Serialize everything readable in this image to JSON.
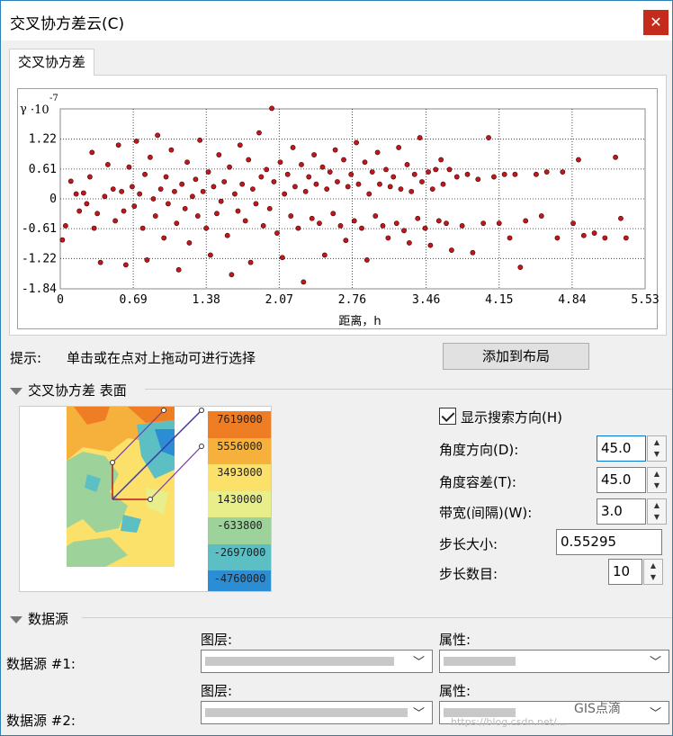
{
  "window": {
    "title": "交叉协方差云(C)",
    "close": "✕"
  },
  "tab": {
    "label": "交叉协方差"
  },
  "plot": {
    "gamma_label": "γ",
    "exp_label": "·10",
    "exp_power": "-7",
    "xlabel": "距离，h"
  },
  "chart_data": {
    "type": "scatter",
    "title": "",
    "xlabel": "距离，h",
    "ylabel": "γ ·10^-7",
    "xlim": [
      0,
      5.53
    ],
    "ylim": [
      -1.84,
      1.84
    ],
    "x_ticks": [
      "0",
      "0.69",
      "1.38",
      "2.07",
      "2.76",
      "3.46",
      "4.15",
      "4.84",
      "5.53"
    ],
    "y_ticks": [
      "1.22",
      "0.61",
      "0",
      "-0.61",
      "-1.22",
      "-1.84"
    ],
    "grid": true,
    "point_color": "#c0181c",
    "series": [
      {
        "points": [
          [
            0.02,
            -0.84
          ],
          [
            0.05,
            -0.55
          ],
          [
            0.1,
            0.36
          ],
          [
            0.15,
            0.1
          ],
          [
            0.18,
            -0.25
          ],
          [
            0.22,
            0.12
          ],
          [
            0.25,
            -0.1
          ],
          [
            0.28,
            0.45
          ],
          [
            0.3,
            0.95
          ],
          [
            0.32,
            -0.6
          ],
          [
            0.35,
            -0.3
          ],
          [
            0.38,
            -1.3
          ],
          [
            0.42,
            0.05
          ],
          [
            0.45,
            0.7
          ],
          [
            0.5,
            0.2
          ],
          [
            0.52,
            -0.45
          ],
          [
            0.55,
            1.1
          ],
          [
            0.58,
            0.15
          ],
          [
            0.6,
            -0.25
          ],
          [
            0.62,
            -1.35
          ],
          [
            0.65,
            0.65
          ],
          [
            0.68,
            0.25
          ],
          [
            0.7,
            -0.15
          ],
          [
            0.72,
            1.18
          ],
          [
            0.75,
            0.1
          ],
          [
            0.78,
            -0.6
          ],
          [
            0.8,
            0.5
          ],
          [
            0.82,
            -1.25
          ],
          [
            0.85,
            0.85
          ],
          [
            0.88,
            0.0
          ],
          [
            0.9,
            -0.35
          ],
          [
            0.92,
            1.3
          ],
          [
            0.95,
            0.2
          ],
          [
            0.98,
            -0.8
          ],
          [
            1.0,
            0.45
          ],
          [
            1.02,
            -0.1
          ],
          [
            1.05,
            1.0
          ],
          [
            1.08,
            0.15
          ],
          [
            1.1,
            -0.5
          ],
          [
            1.12,
            -1.45
          ],
          [
            1.15,
            0.3
          ],
          [
            1.18,
            -0.2
          ],
          [
            1.2,
            0.75
          ],
          [
            1.22,
            -0.9
          ],
          [
            1.25,
            0.05
          ],
          [
            1.28,
            0.4
          ],
          [
            1.3,
            -0.35
          ],
          [
            1.32,
            1.2
          ],
          [
            1.35,
            0.15
          ],
          [
            1.38,
            -0.6
          ],
          [
            1.4,
            0.55
          ],
          [
            1.42,
            -1.15
          ],
          [
            1.45,
            0.25
          ],
          [
            1.48,
            -0.3
          ],
          [
            1.5,
            0.9
          ],
          [
            1.52,
            -0.05
          ],
          [
            1.55,
            0.35
          ],
          [
            1.58,
            -0.75
          ],
          [
            1.6,
            0.65
          ],
          [
            1.62,
            -1.55
          ],
          [
            1.65,
            0.1
          ],
          [
            1.68,
            -0.25
          ],
          [
            1.7,
            1.1
          ],
          [
            1.72,
            0.3
          ],
          [
            1.75,
            -0.45
          ],
          [
            1.78,
            0.8
          ],
          [
            1.8,
            -1.3
          ],
          [
            1.82,
            0.2
          ],
          [
            1.85,
            -0.1
          ],
          [
            1.88,
            1.35
          ],
          [
            1.9,
            0.45
          ],
          [
            1.92,
            -0.55
          ],
          [
            1.95,
            0.6
          ],
          [
            1.98,
            -0.2
          ],
          [
            2.0,
            1.85
          ],
          [
            2.02,
            0.35
          ],
          [
            2.05,
            -0.7
          ],
          [
            2.08,
            0.75
          ],
          [
            2.1,
            -1.2
          ],
          [
            2.12,
            0.1
          ],
          [
            2.15,
            0.5
          ],
          [
            2.18,
            -0.35
          ],
          [
            2.2,
            1.05
          ],
          [
            2.22,
            0.25
          ],
          [
            2.25,
            -0.6
          ],
          [
            2.28,
            0.7
          ],
          [
            2.3,
            -1.7
          ],
          [
            2.32,
            0.15
          ],
          [
            2.35,
            0.45
          ],
          [
            2.38,
            -0.4
          ],
          [
            2.4,
            0.9
          ],
          [
            2.42,
            0.3
          ],
          [
            2.45,
            -0.5
          ],
          [
            2.48,
            0.65
          ],
          [
            2.5,
            -1.15
          ],
          [
            2.52,
            0.2
          ],
          [
            2.55,
            0.55
          ],
          [
            2.58,
            -0.3
          ],
          [
            2.6,
            1.0
          ],
          [
            2.62,
            0.35
          ],
          [
            2.65,
            -0.55
          ],
          [
            2.68,
            0.8
          ],
          [
            2.7,
            -0.85
          ],
          [
            2.72,
            0.25
          ],
          [
            2.75,
            0.5
          ],
          [
            2.78,
            -0.45
          ],
          [
            2.8,
            1.15
          ],
          [
            2.82,
            0.3
          ],
          [
            2.85,
            -0.6
          ],
          [
            2.88,
            0.75
          ],
          [
            2.9,
            -1.25
          ],
          [
            2.92,
            0.1
          ],
          [
            2.95,
            0.55
          ],
          [
            2.98,
            -0.35
          ],
          [
            3.0,
            0.95
          ],
          [
            3.02,
            0.3
          ],
          [
            3.05,
            -0.55
          ],
          [
            3.08,
            0.6
          ],
          [
            3.1,
            -0.8
          ],
          [
            3.12,
            0.25
          ],
          [
            3.15,
            0.45
          ],
          [
            3.18,
            -0.5
          ],
          [
            3.2,
            1.05
          ],
          [
            3.22,
            0.2
          ],
          [
            3.25,
            -0.65
          ],
          [
            3.28,
            0.7
          ],
          [
            3.3,
            -0.9
          ],
          [
            3.32,
            0.15
          ],
          [
            3.35,
            0.5
          ],
          [
            3.38,
            -0.4
          ],
          [
            3.4,
            1.25
          ],
          [
            3.42,
            0.35
          ],
          [
            3.45,
            -0.6
          ],
          [
            3.48,
            0.55
          ],
          [
            3.5,
            -0.95
          ],
          [
            3.52,
            0.2
          ],
          [
            3.55,
            0.6
          ],
          [
            3.58,
            -0.45
          ],
          [
            3.6,
            0.8
          ],
          [
            3.62,
            0.3
          ],
          [
            3.65,
            -0.5
          ],
          [
            3.68,
            0.6
          ],
          [
            3.7,
            -1.05
          ],
          [
            3.75,
            0.45
          ],
          [
            3.8,
            -0.55
          ],
          [
            3.85,
            0.5
          ],
          [
            3.9,
            -1.1
          ],
          [
            3.95,
            0.4
          ],
          [
            4.0,
            -0.5
          ],
          [
            4.05,
            1.25
          ],
          [
            4.1,
            0.45
          ],
          [
            4.15,
            -0.5
          ],
          [
            4.2,
            0.5
          ],
          [
            4.25,
            -0.8
          ],
          [
            4.3,
            0.5
          ],
          [
            4.35,
            -1.4
          ],
          [
            4.4,
            -0.45
          ],
          [
            4.5,
            0.5
          ],
          [
            4.55,
            -0.35
          ],
          [
            4.6,
            0.55
          ],
          [
            4.7,
            -0.8
          ],
          [
            4.75,
            0.55
          ],
          [
            4.85,
            -0.5
          ],
          [
            4.9,
            0.8
          ],
          [
            4.95,
            -0.75
          ],
          [
            5.05,
            -0.7
          ],
          [
            5.15,
            -0.8
          ],
          [
            5.25,
            0.85
          ],
          [
            5.3,
            -0.4
          ],
          [
            5.35,
            -0.8
          ]
        ]
      }
    ]
  },
  "hint": {
    "label": "提示:",
    "text": "单击或在点对上拖动可进行选择"
  },
  "add_to_layout": "添加到布局",
  "surface_section": {
    "title": "交叉协方差 表面"
  },
  "legend": [
    "7619000",
    "5556000",
    "3493000",
    "1430000",
    "-633800",
    "-2697000",
    "-4760000"
  ],
  "legend_colors": [
    "#ef7d24",
    "#f6b13c",
    "#fbe06a",
    "#e8ef8a",
    "#9ed29b",
    "#5bbfc4",
    "#2b8ed4"
  ],
  "search_dir": {
    "label": "显示搜索方向(H)",
    "checked": true
  },
  "fields": {
    "angle_dir": {
      "label": "角度方向(D):",
      "value": "45.0"
    },
    "angle_tol": {
      "label": "角度容差(T):",
      "value": "45.0"
    },
    "bandwidth": {
      "label": "带宽(间隔)(W):",
      "value": "3.0"
    },
    "lag_size": {
      "label": "步长大小:",
      "value": "0.55295"
    },
    "lag_count": {
      "label": "步长数目:",
      "value": "10"
    }
  },
  "datasource_section": {
    "title": "数据源"
  },
  "datasource1": {
    "label": "数据源 #1:",
    "layer_label": "图层:",
    "attr_label": "属性:"
  },
  "datasource2": {
    "label": "数据源 #2:",
    "layer_label": "图层:",
    "attr_label": "属性:"
  },
  "watermark": "GIS点滴",
  "watermark_url": "https://blog.csdn.net/..."
}
